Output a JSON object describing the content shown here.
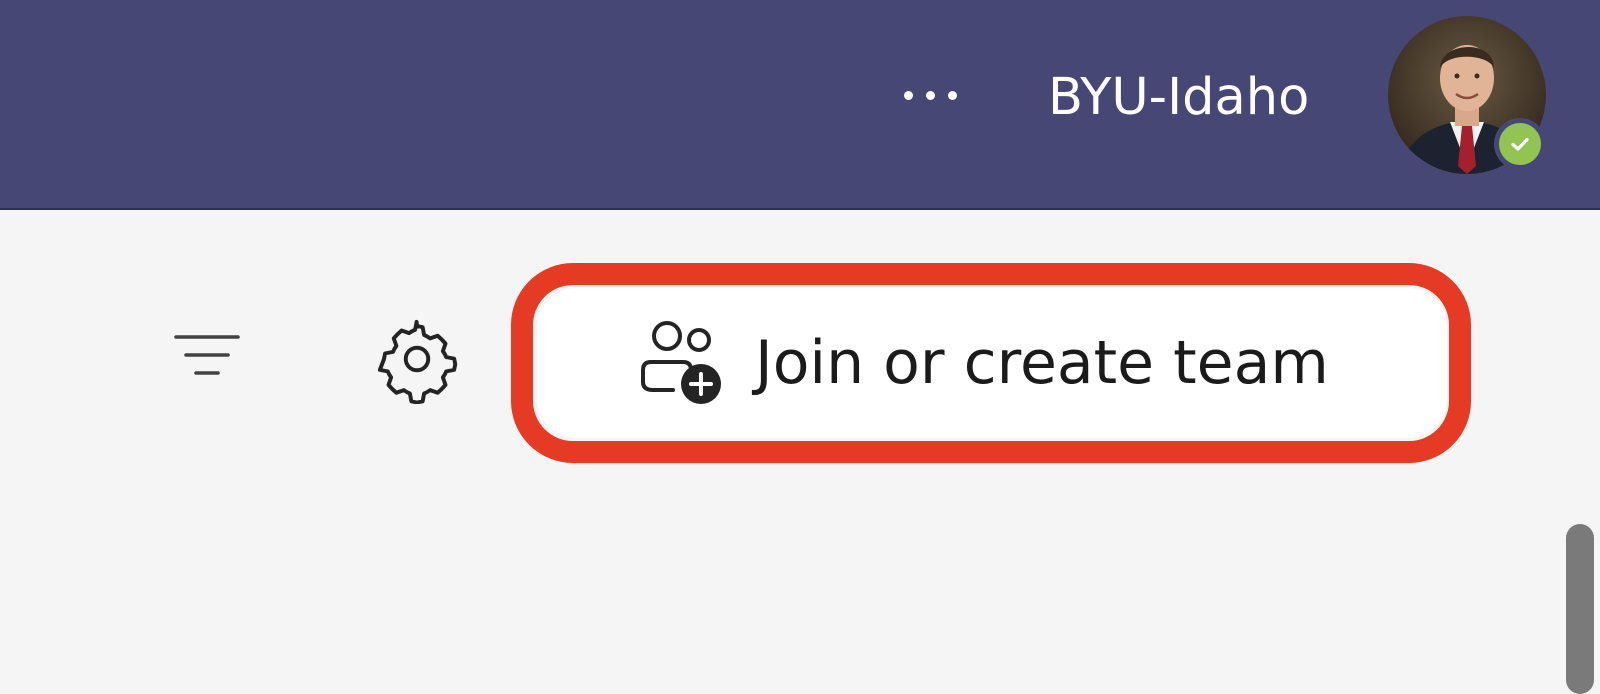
{
  "header": {
    "more_options_icon": "more-horizontal-icon",
    "org_name": "BYU-Idaho",
    "avatar_status": "available",
    "colors": {
      "background": "#464775",
      "presence_available": "#92c353"
    }
  },
  "toolbar": {
    "filter_icon": "filter-icon",
    "settings_icon": "gear-icon",
    "join_button_label": "Join or create team",
    "join_button_icon": "people-add-icon",
    "highlight_color": "#e53a23"
  }
}
